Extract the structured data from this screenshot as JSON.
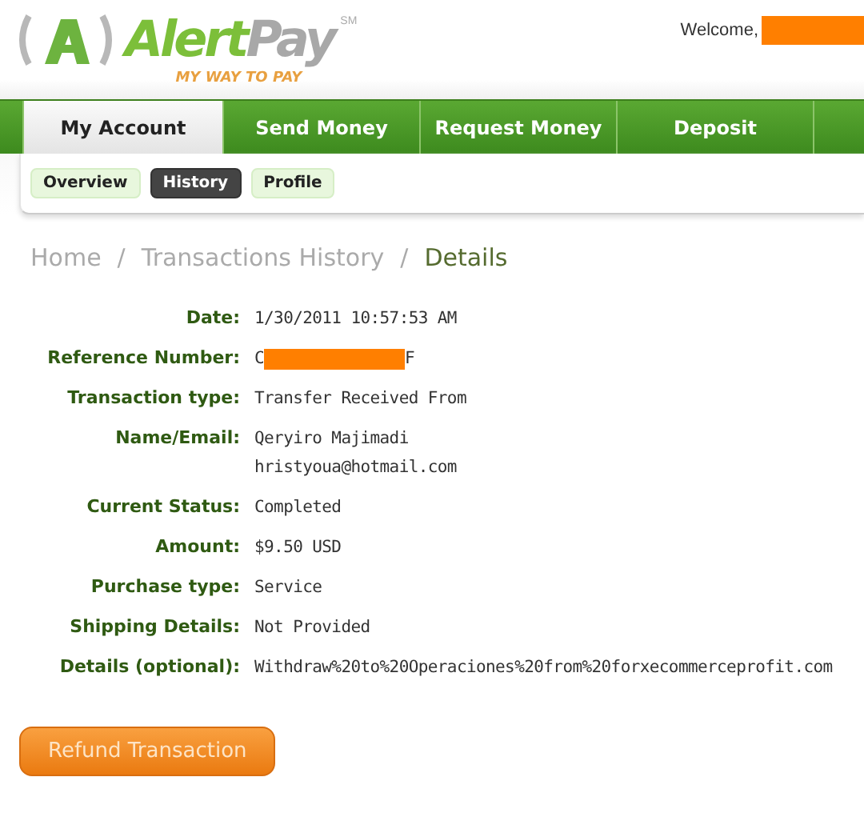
{
  "header": {
    "logo": {
      "word_1": "Alert",
      "word_2": "Pay",
      "trademark": "SM",
      "tagline": "MY WAY TO PAY"
    },
    "welcome": "Welcome,",
    "user_redacted": true
  },
  "main_tabs": [
    {
      "label": "My Account",
      "selected": true
    },
    {
      "label": "Send Money",
      "selected": false
    },
    {
      "label": "Request Money",
      "selected": false
    },
    {
      "label": "Deposit",
      "selected": false
    }
  ],
  "sub_tabs": [
    {
      "label": "Overview",
      "selected": false
    },
    {
      "label": "History",
      "selected": true
    },
    {
      "label": "Profile",
      "selected": false
    }
  ],
  "breadcrumb": [
    {
      "label": "Home",
      "current": false
    },
    {
      "label": "Transactions History",
      "current": false
    },
    {
      "label": "Details",
      "current": true
    }
  ],
  "breadcrumb_separator": "/",
  "details": [
    {
      "label": "Date:",
      "lines": [
        "1/30/2011 10:57:53 AM"
      ]
    },
    {
      "label": "Reference Number:",
      "lines": [
        "C",
        "F"
      ],
      "redacted": true
    },
    {
      "label": "Transaction type:",
      "lines": [
        "Transfer Received From"
      ]
    },
    {
      "label": "Name/Email:",
      "lines": [
        "Qeryiro Majimadi",
        "hristyoua@hotmail.com"
      ]
    },
    {
      "label": "Current Status:",
      "lines": [
        "Completed"
      ]
    },
    {
      "label": "Amount:",
      "lines": [
        "$9.50 USD"
      ]
    },
    {
      "label": "Purchase type:",
      "lines": [
        "Service"
      ]
    },
    {
      "label": "Shipping Details:",
      "lines": [
        "Not Provided"
      ]
    },
    {
      "label": "Details (optional):",
      "lines": [
        "Withdraw%20to%20Operaciones%20from%20forxecommerceprofit.com"
      ]
    }
  ],
  "refund_button": "Refund Transaction"
}
